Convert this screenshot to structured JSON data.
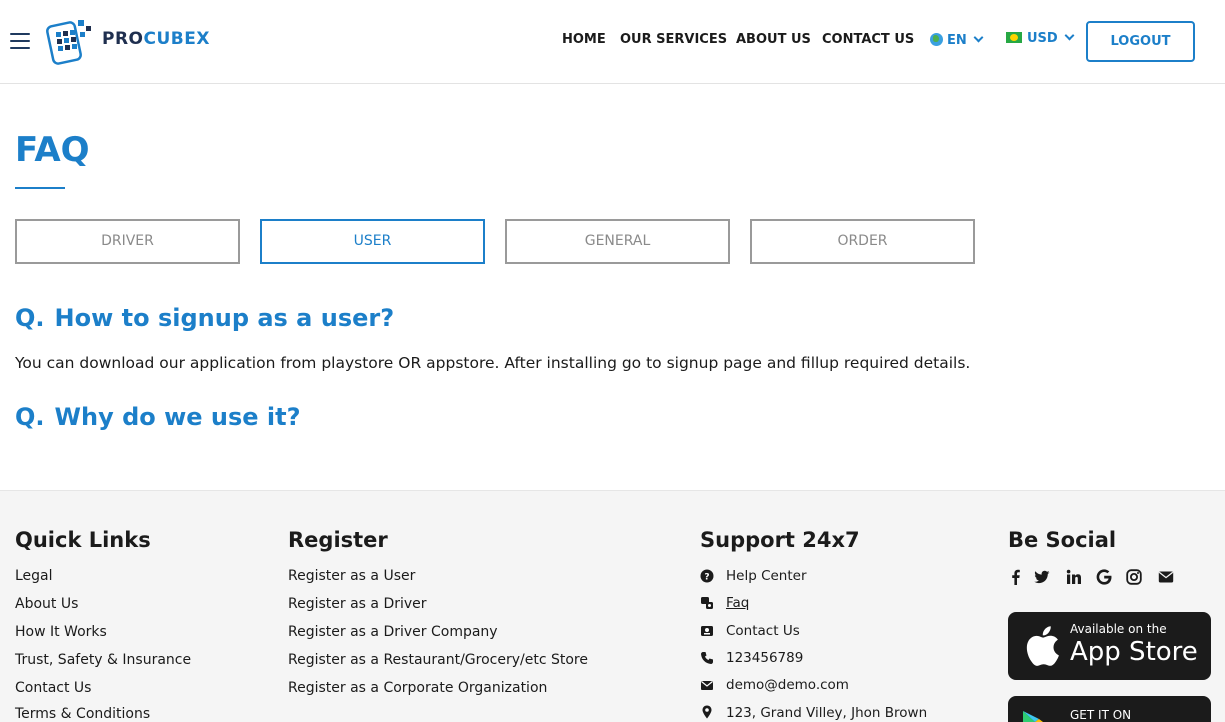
{
  "header": {
    "logo": {
      "part1": "PRO",
      "part2": "CUBEX"
    },
    "nav": [
      "HOME",
      "OUR SERVICES",
      "ABOUT US",
      "CONTACT US"
    ],
    "language": "EN",
    "currency": "USD",
    "logout_label": "LOGOUT"
  },
  "faq": {
    "title": "FAQ",
    "tabs": [
      "DRIVER",
      "USER",
      "GENERAL",
      "ORDER"
    ],
    "active_tab": "USER",
    "question_prefix": "Q.",
    "questions": [
      {
        "question": "How to signup as a user?",
        "answer": "You can download our application from playstore OR appstore. After installing go to signup page and fillup required details."
      },
      {
        "question": "Why do we use it?"
      }
    ]
  },
  "footer": {
    "quick_links": {
      "heading": "Quick Links",
      "items": [
        "Legal",
        "About Us",
        "How It Works",
        "Trust, Safety & Insurance",
        "Contact Us",
        "Terms & Conditions"
      ]
    },
    "register": {
      "heading": "Register",
      "items": [
        "Register as a User",
        "Register as a Driver",
        "Register as a Driver Company",
        "Register as a Restaurant/Grocery/etc Store",
        "Register as a Corporate Organization"
      ]
    },
    "support": {
      "heading": "Support 24x7",
      "items": [
        {
          "icon": "question-circle-icon",
          "label": "Help Center"
        },
        {
          "icon": "faq-icon",
          "label": "Faq"
        },
        {
          "icon": "contact-card-icon",
          "label": "Contact Us"
        },
        {
          "icon": "phone-icon",
          "label": "123456789"
        },
        {
          "icon": "envelope-icon",
          "label": "demo@demo.com"
        },
        {
          "icon": "map-pin-icon",
          "label": "123, Grand Villey, Jhon Brown"
        }
      ]
    },
    "social": {
      "heading": "Be Social",
      "icons": [
        "facebook-icon",
        "twitter-icon",
        "linkedin-icon",
        "google-icon",
        "instagram-icon",
        "envelope-icon"
      ]
    },
    "app_store": {
      "small": "Available on the",
      "big": "App Store"
    },
    "google_play": {
      "small": "GET IT ON"
    }
  },
  "colors": {
    "accent": "#1c7fc9",
    "dark": "#1b1b1b",
    "muted_border": "#9a9a9a",
    "footer_bg": "#f5f5f5"
  }
}
